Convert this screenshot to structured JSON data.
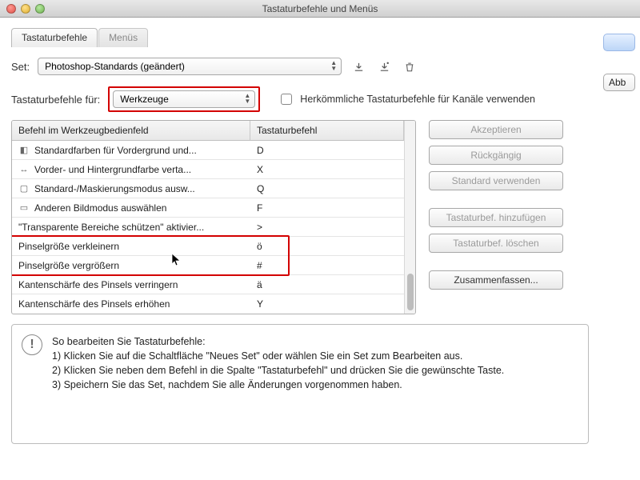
{
  "window": {
    "title": "Tastaturbefehle und Menüs"
  },
  "tabs": {
    "active": "Tastaturbefehle",
    "inactive": "Menüs"
  },
  "set_row": {
    "label": "Set:",
    "value": "Photoshop-Standards (geändert)"
  },
  "shortcuts_for": {
    "label": "Tastaturbefehle für:",
    "value": "Werkzeuge",
    "checkbox_label": "Herkömmliche Tastaturbefehle für Kanäle verwenden"
  },
  "table": {
    "header_cmd": "Befehl im Werkzeugbedienfeld",
    "header_key": "Tastaturbefehl",
    "rows": [
      {
        "icon": "swatch",
        "label": "Standardfarben für Vordergrund und...",
        "key": "D"
      },
      {
        "icon": "swap",
        "label": "Vorder- und Hintergrundfarbe verta...",
        "key": "X"
      },
      {
        "icon": "mask",
        "label": "Standard-/Maskierungsmodus ausw...",
        "key": "Q"
      },
      {
        "icon": "screen",
        "label": "Anderen Bildmodus auswählen",
        "key": "F"
      },
      {
        "icon": "",
        "label": "\"Transparente Bereiche schützen\" aktivier...",
        "key": ">"
      },
      {
        "icon": "",
        "label": "Pinselgröße verkleinern",
        "key": "ö"
      },
      {
        "icon": "",
        "label": "Pinselgröße vergrößern",
        "key": "#"
      },
      {
        "icon": "",
        "label": "Kantenschärfe des Pinsels verringern",
        "key": "ä"
      },
      {
        "icon": "",
        "label": "Kantenschärfe des Pinsels erhöhen",
        "key": "Y"
      }
    ]
  },
  "side_buttons": {
    "accept": "Akzeptieren",
    "undo": "Rückgängig",
    "use_default": "Standard verwenden",
    "add": "Tastaturbef. hinzufügen",
    "delete": "Tastaturbef. löschen",
    "summarize": "Zusammenfassen..."
  },
  "help": {
    "title": "So bearbeiten Sie Tastaturbefehle:",
    "line1": "1) Klicken Sie auf die Schaltfläche \"Neues Set\" oder wählen Sie ein Set zum Bearbeiten aus.",
    "line2": "2) Klicken Sie neben dem Befehl in die Spalte \"Tastaturbefehl\" und drücken Sie die gewünschte Taste.",
    "line3": "3) Speichern Sie das Set, nachdem Sie alle Änderungen vorgenommen haben."
  },
  "right_strip": {
    "cancel": "Abb"
  }
}
